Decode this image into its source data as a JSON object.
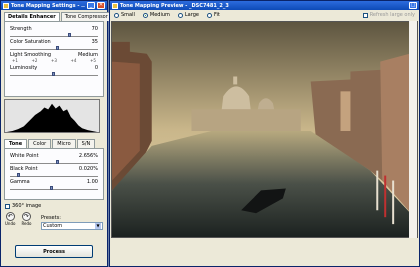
{
  "settings_window": {
    "title": "Tone Mapping Settings - ...",
    "tabs": [
      "Details Enhancer",
      "Tone Compressor"
    ],
    "sliders": [
      {
        "label": "Strength",
        "value": "70",
        "level": 0.7
      },
      {
        "label": "Color Saturation",
        "value": "35",
        "level": 0.55
      },
      {
        "label": "Luminosity",
        "value": "0",
        "level": 0.5
      }
    ],
    "light_smoothing": {
      "label": "Light Smoothing",
      "value": "Medium",
      "ticks": [
        "+1",
        "+2",
        "+3",
        "+4",
        "+5"
      ]
    },
    "tone_tabs": [
      "Tone",
      "Color",
      "Micro",
      "S/N"
    ],
    "tone_sliders": [
      {
        "label": "White Point",
        "value": "2.656%",
        "level": 0.55
      },
      {
        "label": "Black Point",
        "value": "0.020%",
        "level": 0.1
      },
      {
        "label": "Gamma",
        "value": "1.00",
        "level": 0.5
      }
    ],
    "image_360_label": "360° image",
    "undo_label": "Undo",
    "redo_label": "Redo",
    "presets_label": "Presets:",
    "presets_value": "Custom",
    "process_label": "Process"
  },
  "preview_window": {
    "title": "Tone Mapping Preview - _DSC7481_2_3",
    "sizes": [
      "Small",
      "Medium",
      "Large",
      "Fit"
    ],
    "selected_size": "Medium",
    "refresh_label": "Refresh large only"
  },
  "colors": {
    "titlebar": "#0d4ab8",
    "close": "#d8502a"
  }
}
